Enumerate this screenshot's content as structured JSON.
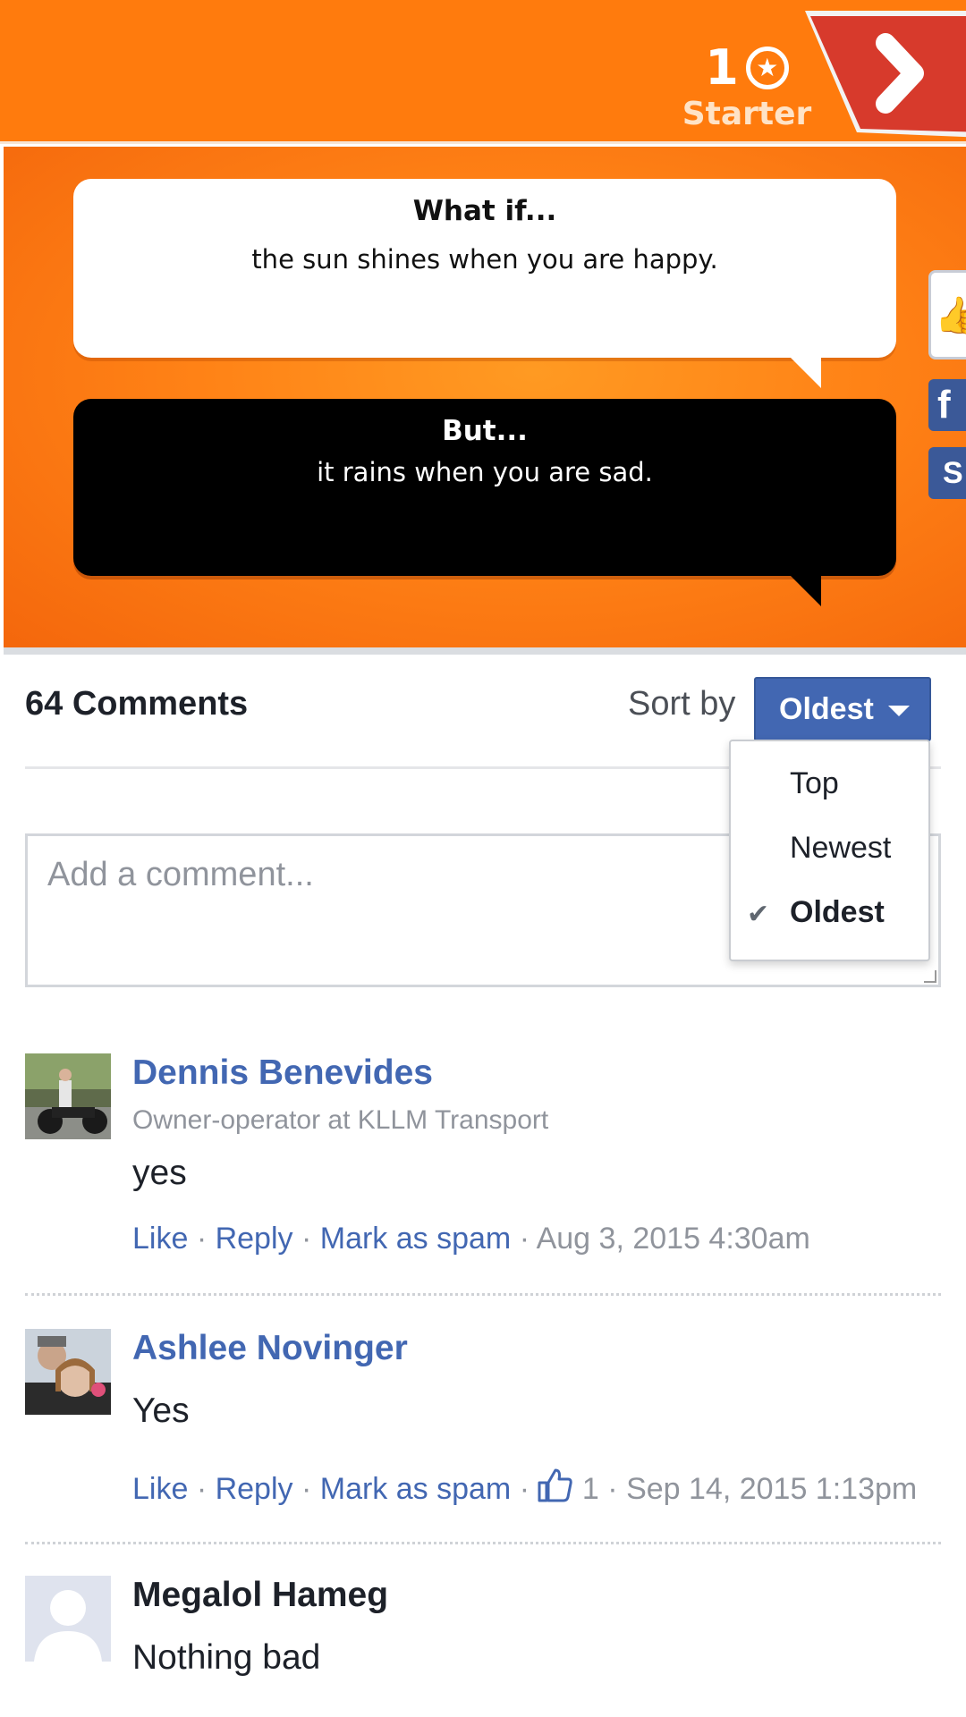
{
  "header": {
    "level_number": "1",
    "level_label": "Starter",
    "star_glyph": "★",
    "next_icon": "chevron-right-icon"
  },
  "banner": {
    "what_if_title": "What if...",
    "what_if_text": "the sun shines when you are happy.",
    "but_title": "But...",
    "but_text": "it rains when you are sad.",
    "side_fb": "f",
    "side_s": "S"
  },
  "comments_header": {
    "count_label": "64 Comments",
    "sort_label": "Sort by",
    "sort_value": "Oldest"
  },
  "sort_dropdown": {
    "options": [
      "Top",
      "Newest",
      "Oldest"
    ],
    "selected": "Oldest",
    "check_glyph": "✔"
  },
  "comment_box": {
    "placeholder": "Add a comment..."
  },
  "comments": [
    {
      "author": "Dennis Benevides",
      "subtitle": "Owner-operator at KLLM Transport",
      "text": "yes",
      "like": "Like",
      "reply": "Reply",
      "spam": "Mark as spam",
      "sep": " · ",
      "timestamp": "Aug 3, 2015 4:30am"
    },
    {
      "author": "Ashlee Novinger",
      "text": "Yes",
      "like": "Like",
      "reply": "Reply",
      "spam": "Mark as spam",
      "sep": " · ",
      "likes_count": "1",
      "timestamp": "Sep 14, 2015 1:13pm"
    },
    {
      "author": "Megalol Hameg",
      "text": "Nothing bad"
    }
  ],
  "colors": {
    "header_orange": "#ff7b0d",
    "link_blue": "#4267b2",
    "next_red": "#d73a2c"
  }
}
